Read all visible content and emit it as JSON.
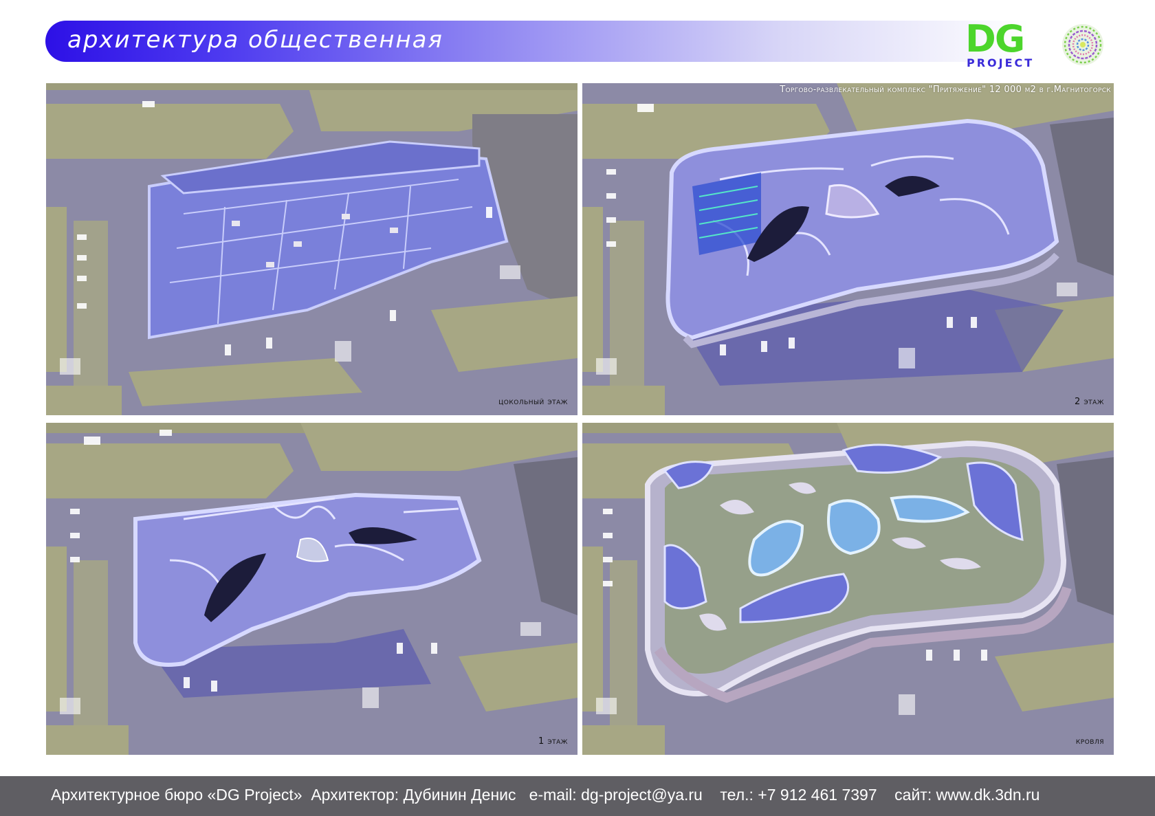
{
  "header": {
    "title": "архитектура общественная",
    "logo_main": "DG",
    "logo_sub": "PROJECT"
  },
  "project_title": "Торгово-развлекательный комплекс \"Притяжение\" 12 000 м2 в г.Магнитогорск",
  "panels": [
    {
      "caption": "цокольный этаж"
    },
    {
      "caption": "2 этаж"
    },
    {
      "caption": "1 этаж"
    },
    {
      "caption": "кровля"
    }
  ],
  "footer": {
    "text": "Архитектурное бюро «DG Project»  Архитектор: Дубинин Денис   e-mail: dg-project@ya.ru    тел.: +7 912 461 7397    сайт: www.dk.3dn.ru"
  },
  "colors": {
    "banner_start": "#2d10e6",
    "logo_green": "#4cd52c",
    "logo_blue": "#3b2bd9",
    "footer_bg": "#5f5e63",
    "road": "#8c8aa6",
    "grass": "#a9a982",
    "building": "#6f73d9"
  }
}
